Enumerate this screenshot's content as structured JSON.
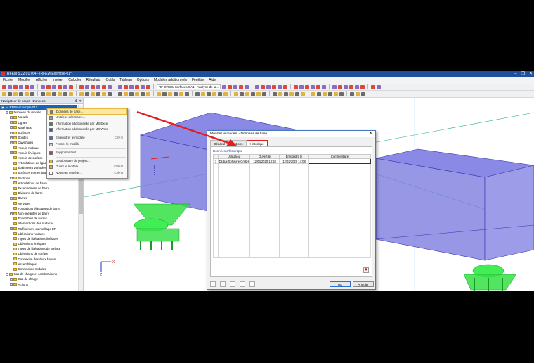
{
  "window": {
    "title": "RFEM 5.22.01 x64 - [RFEM-Exemple-01*]",
    "buttons": [
      "–",
      "❐",
      "✕"
    ]
  },
  "menu": [
    "Fichier",
    "Modifier",
    "Afficher",
    "Insérer",
    "Calculer",
    "Résultats",
    "Outils",
    "Tableau",
    "Options",
    "Modules additionnels",
    "Fenêtre",
    "Aide"
  ],
  "toolbar": {
    "combo_text": "RF-STEEL Surfaces CA1 - Analyse de la...",
    "colors": [
      "#3b73c6",
      "#d84a3a",
      "#e2b33c",
      "#5aa55a",
      "#8a6bbf",
      "#6b6b6b"
    ]
  },
  "navigator": {
    "title": "Navigateur de projet - Données",
    "controls": "⇕ ✕",
    "items": [
      {
        "label": "RFEM-Exemple-01*",
        "indent": 0,
        "exp": "−",
        "selected": true
      },
      {
        "label": "Données du modèle",
        "indent": 1,
        "exp": "−"
      },
      {
        "label": "Nœuds",
        "indent": 2,
        "exp": "+"
      },
      {
        "label": "Lignes",
        "indent": 2,
        "exp": "+"
      },
      {
        "label": "Matériaux",
        "indent": 2,
        "exp": "+"
      },
      {
        "label": "Surfaces",
        "indent": 2,
        "exp": "+"
      },
      {
        "label": "Solides",
        "indent": 2,
        "exp": "+"
      },
      {
        "label": "Ouvertures",
        "indent": 2,
        "exp": "+"
      },
      {
        "label": "Appuis nodaux",
        "indent": 2,
        "exp": ""
      },
      {
        "label": "Appuis linéiques",
        "indent": 2,
        "exp": "+"
      },
      {
        "label": "Appuis de surface",
        "indent": 2,
        "exp": ""
      },
      {
        "label": "Articulations de lignes",
        "indent": 2,
        "exp": ""
      },
      {
        "label": "Épaisseurs variables",
        "indent": 2,
        "exp": ""
      },
      {
        "label": "Surfaces et membranes",
        "indent": 2,
        "exp": ""
      },
      {
        "label": "Sections",
        "indent": 2,
        "exp": "+"
      },
      {
        "label": "Articulations de barre",
        "indent": 2,
        "exp": ""
      },
      {
        "label": "Excentrement de barre",
        "indent": 2,
        "exp": ""
      },
      {
        "label": "Divisions de barre",
        "indent": 2,
        "exp": ""
      },
      {
        "label": "Barres",
        "indent": 2,
        "exp": "+"
      },
      {
        "label": "Nervures",
        "indent": 2,
        "exp": ""
      },
      {
        "label": "Fondations élastiques de barre",
        "indent": 2,
        "exp": ""
      },
      {
        "label": "Non-linéarités de barre",
        "indent": 2,
        "exp": "+"
      },
      {
        "label": "Ensembles de barres",
        "indent": 2,
        "exp": ""
      },
      {
        "label": "Intersections des surfaces",
        "indent": 2,
        "exp": ""
      },
      {
        "label": "Raffinement du maillage EF",
        "indent": 2,
        "exp": "+"
      },
      {
        "label": "Libérations nodales",
        "indent": 2,
        "exp": ""
      },
      {
        "label": "Types de libérations linéiques",
        "indent": 2,
        "exp": ""
      },
      {
        "label": "Libérations linéiques",
        "indent": 2,
        "exp": ""
      },
      {
        "label": "Types de libérations de surface",
        "indent": 2,
        "exp": ""
      },
      {
        "label": "Libérations de surface",
        "indent": 2,
        "exp": ""
      },
      {
        "label": "Connexion des deux barres",
        "indent": 2,
        "exp": ""
      },
      {
        "label": "Assemblages",
        "indent": 2,
        "exp": ""
      },
      {
        "label": "Connexions nodales",
        "indent": 2,
        "exp": ""
      },
      {
        "label": "Cas de charge et combinaisons",
        "indent": 1,
        "exp": "−"
      },
      {
        "label": "Cas de charge",
        "indent": 2,
        "exp": "+"
      },
      {
        "label": "Actions",
        "indent": 2,
        "exp": "+"
      }
    ]
  },
  "context_menu": [
    {
      "label": "Données de base...",
      "shortcut": "",
      "highlight": true,
      "icon": "#4f7fd0"
    },
    {
      "label": "Unités et décimales...",
      "shortcut": "",
      "icon": "#a0a0a0"
    },
    {
      "label": "Information additionnelle par MS Excel",
      "shortcut": "",
      "icon": "#2f8a4a"
    },
    {
      "label": "Information additionnelle par MS Word",
      "shortcut": "",
      "icon": "#2b5fb5"
    },
    {
      "sep": true
    },
    {
      "label": "Enregistrer le modèle",
      "shortcut": "Ctrl+S",
      "icon": "#3b6fc0"
    },
    {
      "label": "Fermer le modèle",
      "shortcut": "",
      "icon": "#d0d0d0"
    },
    {
      "sep": true
    },
    {
      "label": "Supprimer tout",
      "shortcut": "",
      "icon": "#c03a3a"
    },
    {
      "sep": true
    },
    {
      "label": "Gestionnaire de projets...",
      "shortcut": "",
      "icon": "#e0b040"
    },
    {
      "label": "Ouvrir le modèle...",
      "shortcut": "Ctrl+O",
      "icon": "#e0b040"
    },
    {
      "label": "Nouveau modèle...",
      "shortcut": "Ctrl+N",
      "icon": "#ffffff"
    }
  ],
  "dialog": {
    "title": "Modifier le modèle - Données de base",
    "tabs": [
      "Général",
      "Options",
      "Historique"
    ],
    "group_label": "Données d'historique",
    "columns": [
      "",
      "Utilisateur",
      "Ouvert le",
      "Enregistré le",
      "Commentaire"
    ],
    "rows": [
      {
        "num": "1",
        "user": "Dlubal Software GmbH",
        "opened": "12/03/2020 13:58",
        "saved": "12/03/2020 14:08",
        "comment": ""
      }
    ],
    "ok": "OK",
    "cancel": "Annuler"
  },
  "viewport": {
    "axis_x": "X",
    "axis_z": "Z"
  }
}
